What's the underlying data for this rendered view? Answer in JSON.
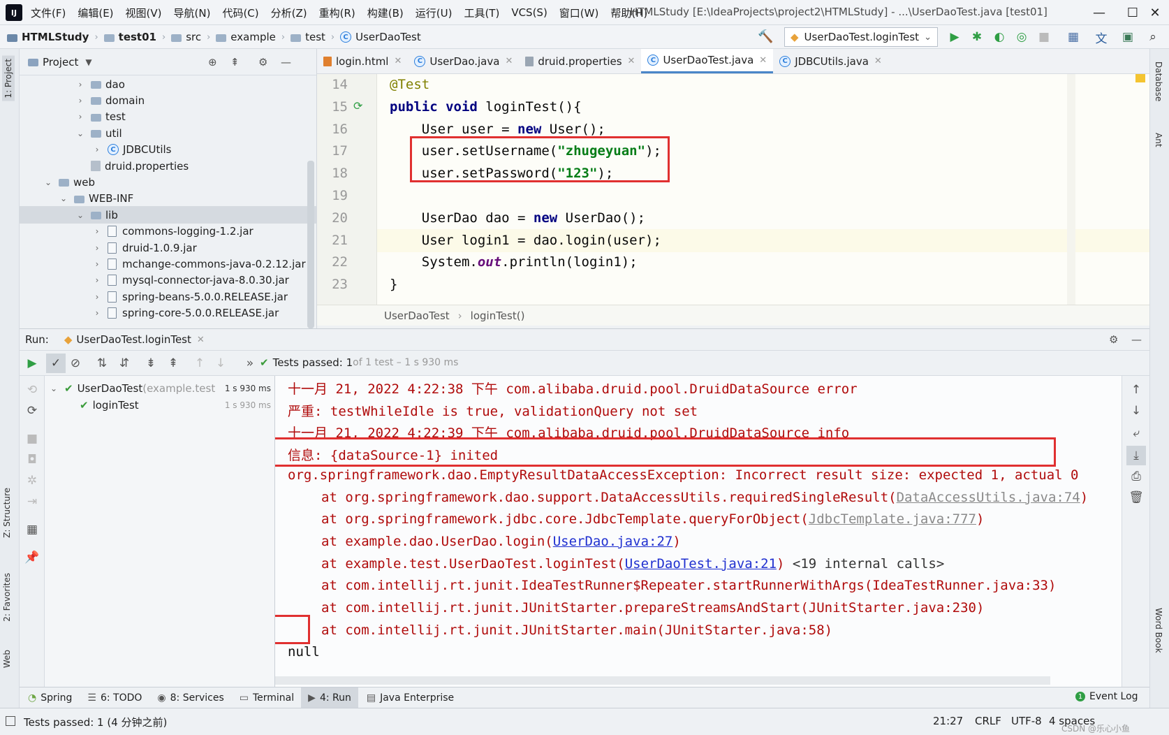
{
  "menu": {
    "items": [
      "文件(F)",
      "编辑(E)",
      "视图(V)",
      "导航(N)",
      "代码(C)",
      "分析(Z)",
      "重构(R)",
      "构建(B)",
      "运行(U)",
      "工具(T)",
      "VCS(S)",
      "窗口(W)",
      "帮助(H)"
    ],
    "window_title": "HTMLStudy [E:\\IdeaProjects\\project2\\HTMLStudy] - ...\\UserDaoTest.java [test01]"
  },
  "nav": {
    "crumbs": [
      "HTMLStudy",
      "test01",
      "src",
      "example",
      "test",
      "UserDaoTest"
    ],
    "run_config": "UserDaoTest.loginTest"
  },
  "left_strip": {
    "project_tab": "1: Project",
    "structure_tab": "Z: Structure",
    "favorites_tab": "2: Favorites",
    "web_tab": "Web"
  },
  "right_strip": {
    "database_tab": "Database",
    "ant_tab": "Ant",
    "wordbook_tab": "Word Book"
  },
  "project": {
    "title": "Project",
    "tree": [
      {
        "label": "dao",
        "type": "folder",
        "depth": 3,
        "arrow": "›"
      },
      {
        "label": "domain",
        "type": "folder",
        "depth": 3,
        "arrow": "›"
      },
      {
        "label": "test",
        "type": "folder",
        "depth": 3,
        "arrow": "›"
      },
      {
        "label": "util",
        "type": "folder",
        "depth": 3,
        "arrow": "⌄"
      },
      {
        "label": "JDBCUtils",
        "type": "class",
        "depth": 4,
        "arrow": "›"
      },
      {
        "label": "druid.properties",
        "type": "prop",
        "depth": 3,
        "arrow": ""
      },
      {
        "label": "web",
        "type": "folder",
        "depth": 1,
        "arrow": "⌄"
      },
      {
        "label": "WEB-INF",
        "type": "folder",
        "depth": 2,
        "arrow": "⌄"
      },
      {
        "label": "lib",
        "type": "folder",
        "depth": 3,
        "arrow": "⌄"
      },
      {
        "label": "commons-logging-1.2.jar",
        "type": "jar",
        "depth": 4,
        "arrow": "›"
      },
      {
        "label": "druid-1.0.9.jar",
        "type": "jar",
        "depth": 4,
        "arrow": "›"
      },
      {
        "label": "mchange-commons-java-0.2.12.jar",
        "type": "jar",
        "depth": 4,
        "arrow": "›"
      },
      {
        "label": "mysql-connector-java-8.0.30.jar",
        "type": "jar",
        "depth": 4,
        "arrow": "›"
      },
      {
        "label": "spring-beans-5.0.0.RELEASE.jar",
        "type": "jar",
        "depth": 4,
        "arrow": "›"
      },
      {
        "label": "spring-core-5.0.0.RELEASE.jar",
        "type": "jar",
        "depth": 4,
        "arrow": "›"
      }
    ]
  },
  "editor_tabs": [
    {
      "label": "login.html",
      "kind": "html"
    },
    {
      "label": "UserDao.java",
      "kind": "class"
    },
    {
      "label": "druid.properties",
      "kind": "prop"
    },
    {
      "label": "UserDaoTest.java",
      "kind": "class",
      "active": true
    },
    {
      "label": "JDBCUtils.java",
      "kind": "class"
    }
  ],
  "code_lines": [
    {
      "num": "14",
      "html": "<span class=\"ann\">@Test</span>"
    },
    {
      "num": "15",
      "html": "<span class=\"kw\">public void</span> loginTest(){"
    },
    {
      "num": "16",
      "html": "    User user = <span class=\"kw\">new</span> User();"
    },
    {
      "num": "17",
      "html": "    user.setUsername(<span class=\"str\">\"zhugeyuan\"</span>);"
    },
    {
      "num": "18",
      "html": "    user.setPassword(<span class=\"str\">\"123\"</span>);"
    },
    {
      "num": "19",
      "html": ""
    },
    {
      "num": "20",
      "html": "    UserDao dao = <span class=\"kw\">new</span> UserDao();"
    },
    {
      "num": "21",
      "html": "    User login1 = dao.login(user);"
    },
    {
      "num": "22",
      "html": "    System.<span class=\"fld\">out</span>.println(login1);"
    },
    {
      "num": "23",
      "html": "}"
    }
  ],
  "editor_breadcrumb": [
    "UserDaoTest",
    "loginTest()"
  ],
  "run": {
    "label": "Run:",
    "config": "UserDaoTest.loginTest",
    "status_bold": "Tests passed: 1",
    "status_rest": " of 1 test – 1 s 930 ms",
    "tree": [
      {
        "label": "UserDaoTest",
        "sub": " (example.test",
        "time": "1 s 930 ms"
      },
      {
        "label": "loginTest",
        "sub": "",
        "time": "1 s 930 ms"
      }
    ]
  },
  "console_lines": [
    {
      "cls": "",
      "html": "十一月 21, 2022 4:22:38 下午 com.alibaba.druid.pool.DruidDataSource error"
    },
    {
      "cls": "",
      "html": "严重: testWhileIdle is true, validationQuery not set"
    },
    {
      "cls": "",
      "html": "十一月 21, 2022 4:22:39 下午 com.alibaba.druid.pool.DruidDataSource info"
    },
    {
      "cls": "",
      "html": "信息: {dataSource-1} inited"
    },
    {
      "cls": "",
      "html": "org.springframework.dao.EmptyResultDataAccessException: Incorrect result size: expected 1, actual 0"
    },
    {
      "cls": "ind",
      "html": "at org.springframework.dao.support.DataAccessUtils.requiredSingleResult(<span class=\"glink\">DataAccessUtils.java:74</span>)"
    },
    {
      "cls": "ind",
      "html": "at org.springframework.jdbc.core.JdbcTemplate.queryForObject(<span class=\"glink\">JdbcTemplate.java:777</span>)"
    },
    {
      "cls": "ind",
      "html": "at example.dao.UserDao.login(<span class=\"link\">UserDao.java:27</span>)"
    },
    {
      "cls": "ind",
      "html": "at example.test.UserDaoTest.loginTest(<span class=\"link\">UserDaoTest.java:21</span>) <span class=\"gray\">&lt;19 internal calls&gt;</span>"
    },
    {
      "cls": "ind",
      "html": "at com.intellij.rt.junit.IdeaTestRunner$Repeater.startRunnerWithArgs(IdeaTestRunner.java:33)"
    },
    {
      "cls": "ind",
      "html": "at com.intellij.rt.junit.JUnitStarter.prepareStreamsAndStart(JUnitStarter.java:230)"
    },
    {
      "cls": "ind",
      "html": "at com.intellij.rt.junit.JUnitStarter.main(JUnitStarter.java:58)"
    },
    {
      "cls": "plain",
      "html": "null"
    }
  ],
  "tool_tabs": [
    {
      "label": "Spring",
      "icon": "spring-icon"
    },
    {
      "label": "6: TODO",
      "icon": "todo-icon"
    },
    {
      "label": "8: Services",
      "icon": "services-icon"
    },
    {
      "label": "Terminal",
      "icon": "terminal-icon"
    },
    {
      "label": "4: Run",
      "icon": "run-icon",
      "active": true
    },
    {
      "label": "Java Enterprise",
      "icon": "java-enterprise-icon"
    }
  ],
  "event_log": "Event Log",
  "status": {
    "message": "Tests passed: 1 (4 分钟之前)",
    "position": "21:27",
    "line_sep": "CRLF",
    "encoding": "UTF-8",
    "indent": "4 spaces",
    "watermark": "CSDN @乐心小鱼"
  }
}
